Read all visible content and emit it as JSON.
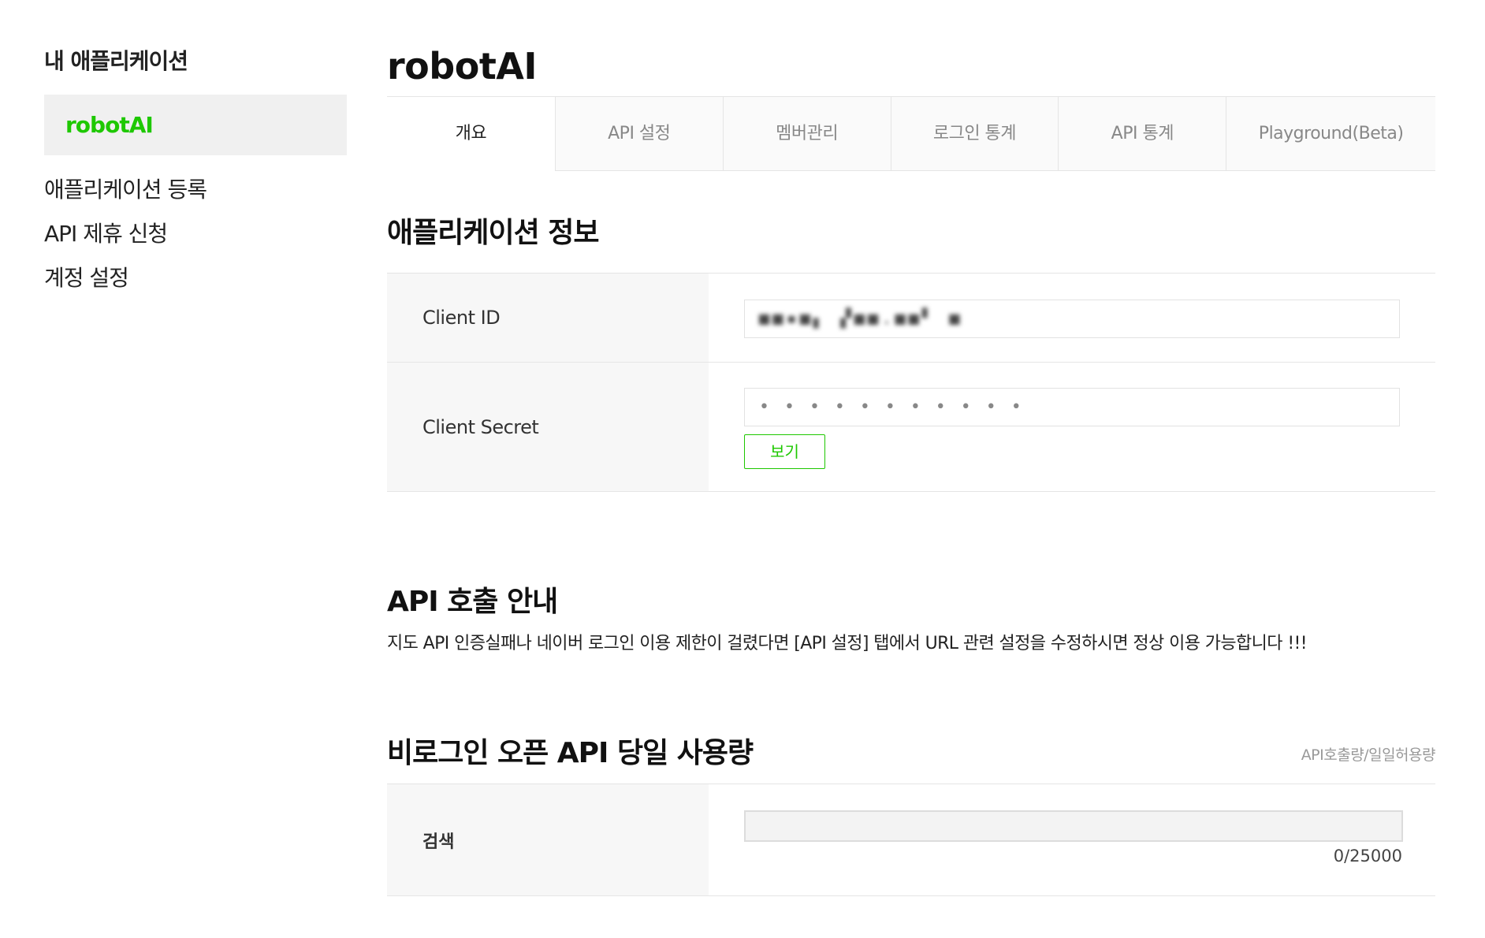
{
  "sidebar": {
    "title": "내 애플리케이션",
    "active_app": "robotAI",
    "links": [
      "애플리케이션 등록",
      "API 제휴 신청",
      "계정 설정"
    ]
  },
  "main": {
    "app_title": "robotAI",
    "tabs": [
      "개요",
      "API 설정",
      "멤버관리",
      "로그인 통계",
      "API 통계",
      "Playground(Beta)"
    ],
    "active_tab": "개요"
  },
  "app_info": {
    "title": "애플리케이션 정보",
    "client_id_label": "Client ID",
    "client_id_value": "■■▪■▖ ▞■■.■■▘ ■",
    "client_secret_label": "Client Secret",
    "client_secret_value": "• • • • • • • • • • •",
    "show_button": "보기"
  },
  "api_notice": {
    "title": "API 호출 안내",
    "description": "지도 API 인증실패나 네이버 로그인 이용 제한이 걸렸다면 [API 설정] 탭에서 URL 관련 설정을 수정하시면 정상 이용 가능합니다 !!!"
  },
  "usage": {
    "title": "비로그인 오픈 API 당일 사용량",
    "hint": "API호출량/일일허용량",
    "rows": [
      {
        "label": "검색",
        "used": 0,
        "limit": 25000,
        "count_text": "0/25000"
      }
    ]
  },
  "colors": {
    "accent": "#1ec800",
    "active_bg": "#f0f0f0",
    "label_bg": "#f7f7f7"
  }
}
